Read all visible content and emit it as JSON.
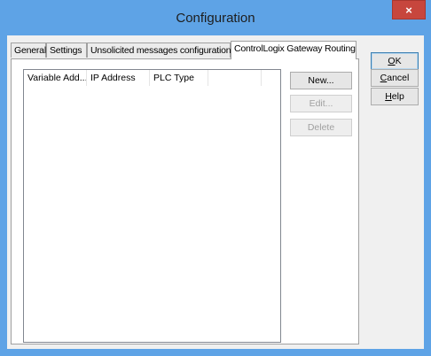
{
  "window": {
    "title": "Configuration",
    "close_symbol": "×"
  },
  "tabs": [
    {
      "label": "General",
      "active": false
    },
    {
      "label": "Settings",
      "active": false
    },
    {
      "label": "Unsolicited messages configuration",
      "active": false
    },
    {
      "label": "ControlLogix Gateway Routing",
      "active": true
    }
  ],
  "list": {
    "columns": [
      "Variable Add...",
      "IP Address",
      "PLC Type",
      ""
    ],
    "rows": []
  },
  "panel_buttons": {
    "new": "New...",
    "edit": "Edit...",
    "delete": "Delete"
  },
  "dialog_buttons": {
    "ok_mnemonic": "O",
    "ok_rest": "K",
    "cancel_mnemonic": "C",
    "cancel_rest": "ancel",
    "help_mnemonic": "H",
    "help_rest": "elp"
  },
  "colors": {
    "titlebar": "#5ea3e6",
    "close": "#c7463d",
    "client": "#f0f0f0"
  }
}
